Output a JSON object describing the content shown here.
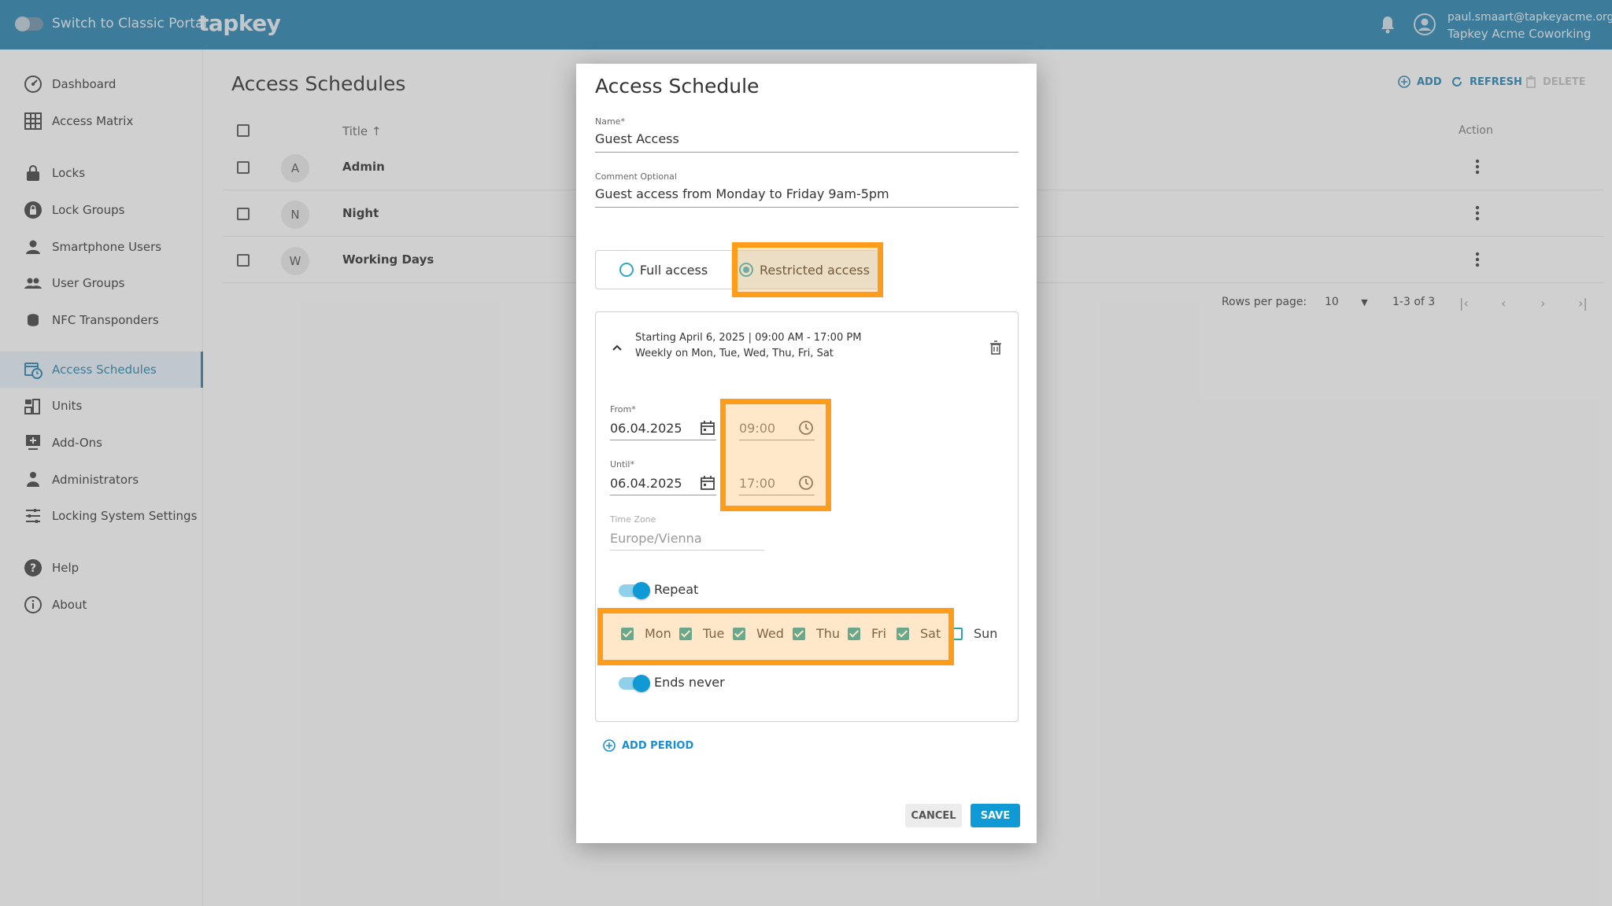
{
  "topbar": {
    "switch_label": "Switch to Classic Portal",
    "logo": "tapkey",
    "user_email": "paul.smaart@tapkeyacme.org",
    "user_org": "Tapkey Acme Coworking"
  },
  "sidebar": {
    "items": [
      {
        "label": "Dashboard",
        "icon": "dashboard-icon"
      },
      {
        "label": "Access Matrix",
        "icon": "grid-icon"
      },
      {
        "label": "Locks",
        "icon": "lock-icon"
      },
      {
        "label": "Lock Groups",
        "icon": "lock-groups-icon"
      },
      {
        "label": "Smartphone Users",
        "icon": "person-icon"
      },
      {
        "label": "User Groups",
        "icon": "group-icon"
      },
      {
        "label": "NFC Transponders",
        "icon": "transponder-icon"
      },
      {
        "label": "Access Schedules",
        "icon": "calendar-clock-icon"
      },
      {
        "label": "Units",
        "icon": "units-icon"
      },
      {
        "label": "Add-Ons",
        "icon": "addon-icon"
      },
      {
        "label": "Administrators",
        "icon": "admin-icon"
      },
      {
        "label": "Locking System Settings",
        "icon": "sliders-icon"
      },
      {
        "label": "Help",
        "icon": "help-icon"
      },
      {
        "label": "About",
        "icon": "info-icon"
      }
    ]
  },
  "main": {
    "title": "Access Schedules",
    "toolbar": {
      "add": "ADD",
      "refresh": "REFRESH",
      "delete": "DELETE"
    },
    "columns": {
      "title": "Title",
      "action": "Action"
    },
    "rows": [
      {
        "avatar": "A",
        "title": "Admin"
      },
      {
        "avatar": "N",
        "title": "Night"
      },
      {
        "avatar": "W",
        "title": "Working Days"
      }
    ],
    "pager": {
      "rows_label": "Rows per page:",
      "rows_value": "10",
      "range": "1-3 of 3"
    }
  },
  "modal": {
    "title": "Access Schedule",
    "name_label": "Name*",
    "name_value": "Guest Access",
    "comment_label": "Comment Optional",
    "comment_value": "Guest access from Monday to Friday 9am-5pm",
    "access_full": "Full access",
    "access_restricted": "Restricted access",
    "period": {
      "summary_line1": "Starting April 6, 2025 | 09:00 AM - 17:00 PM",
      "summary_line2": "Weekly on Mon, Tue, Wed, Thu, Fri, Sat",
      "from_label": "From*",
      "from_date": "06.04.2025",
      "from_time": "09:00",
      "until_label": "Until*",
      "until_date": "06.04.2025",
      "until_time": "17:00",
      "tz_label": "Time Zone",
      "tz_value": "Europe/Vienna",
      "repeat_label": "Repeat",
      "days": [
        {
          "label": "Mon",
          "checked": true
        },
        {
          "label": "Tue",
          "checked": true
        },
        {
          "label": "Wed",
          "checked": true
        },
        {
          "label": "Thu",
          "checked": true
        },
        {
          "label": "Fri",
          "checked": true
        },
        {
          "label": "Sat",
          "checked": true
        },
        {
          "label": "Sun",
          "checked": false
        }
      ],
      "ends_never_label": "Ends never"
    },
    "add_period": "ADD PERIOD",
    "cancel": "CANCEL",
    "save": "SAVE"
  },
  "colors": {
    "topbar": "#2d7fa8",
    "accent": "#0f9ad6",
    "highlight": "#ff9c1a",
    "checkbox": "#2aa4a8"
  }
}
